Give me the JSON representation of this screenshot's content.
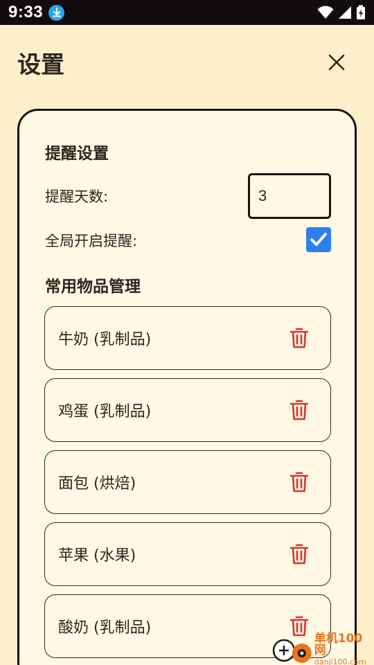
{
  "status_bar": {
    "time": "9:33",
    "icons": [
      "download-icon",
      "wifi-icon",
      "signal-icon",
      "battery-charging-icon"
    ]
  },
  "header": {
    "title": "设置",
    "close_icon": "close-icon"
  },
  "reminder": {
    "section_title": "提醒设置",
    "days_label": "提醒天数:",
    "days_value": "3",
    "global_label": "全局开启提醒:",
    "global_enabled": true
  },
  "items_section": {
    "title": "常用物品管理",
    "items": [
      {
        "label": "牛奶 (乳制品)"
      },
      {
        "label": "鸡蛋 (乳制品)"
      },
      {
        "label": "面包 (烘焙)"
      },
      {
        "label": "苹果 (水果)"
      },
      {
        "label": "酸奶 (乳制品)"
      }
    ]
  },
  "colors": {
    "background": "#fdefc9",
    "card": "#fff8e4",
    "accent": "#2d7ff0",
    "delete": "#d8342c"
  },
  "watermark": {
    "main": "单机100网",
    "sub": "danji100.com"
  }
}
